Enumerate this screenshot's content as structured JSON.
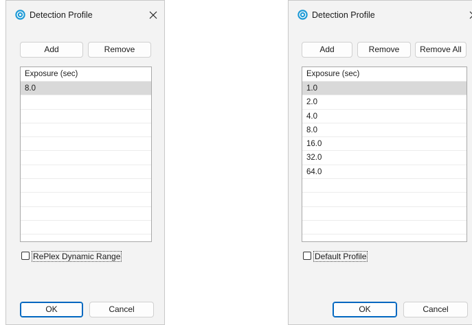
{
  "left_dialog": {
    "title": "Detection Profile",
    "add_label": "Add",
    "remove_label": "Remove",
    "list_header": "Exposure (sec)",
    "rows": [
      "8.0",
      "",
      "",
      "",
      "",
      "",
      "",
      "",
      "",
      "",
      ""
    ],
    "checkbox_label": "RePlex Dynamic Range",
    "ok_label": "OK",
    "cancel_label": "Cancel"
  },
  "right_dialog": {
    "title": "Detection Profile",
    "add_label": "Add",
    "remove_label": "Remove",
    "remove_all_label": "Remove All",
    "list_header": "Exposure (sec)",
    "rows": [
      "1.0",
      "2.0",
      "4.0",
      "8.0",
      "16.0",
      "32.0",
      "64.0",
      "",
      "",
      "",
      "",
      ""
    ],
    "checkbox_label": "Default Profile",
    "ok_label": "OK",
    "cancel_label": "Cancel"
  },
  "colors": {
    "dialog_bg": "#f3f3f3",
    "selected_row": "#d9d9d9",
    "primary_border": "#0067c0",
    "app_icon": "#1e9ad6"
  },
  "icons": {
    "app": "app-logo-icon",
    "close": "close-icon"
  }
}
